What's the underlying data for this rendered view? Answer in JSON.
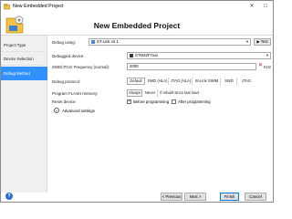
{
  "window": {
    "title": "New Embedded Project",
    "close_label": "✕",
    "max_label": "□"
  },
  "header": {
    "title": "New Embedded Project"
  },
  "sidebar": {
    "items": [
      {
        "label": "Project Type"
      },
      {
        "label": "Device Selection"
      },
      {
        "label": "Debug Method"
      }
    ]
  },
  "form": {
    "debug_using": {
      "label": "Debug using:",
      "value": "ST-Link v2.1",
      "test_label": "Test"
    },
    "debugged_device": {
      "label": "Debugged device:",
      "value": "STM32F7xxx"
    },
    "frequency": {
      "label": "SWD/JTAG Frequency (normal):",
      "value": "2000",
      "unit": "KHz"
    },
    "debug_protocol": {
      "label": "Debug protocol:",
      "options": [
        "Default",
        "SWD (HLA)",
        "JTAG (HLA)",
        "St-Link SWIM",
        "SWD",
        "JTAG"
      ]
    },
    "program_flash": {
      "label": "Program FLASH memory:",
      "options": [
        "Always",
        "Never",
        "If rebuilt since last load"
      ]
    },
    "reset_device": {
      "label": "Reset device:",
      "before": "Before programming",
      "after": "After programming"
    },
    "advanced": {
      "label": "Advanced settings"
    }
  },
  "footer": {
    "previous": "< Previous",
    "next": "Next >",
    "finish": "Finish",
    "cancel": "Cancel"
  }
}
